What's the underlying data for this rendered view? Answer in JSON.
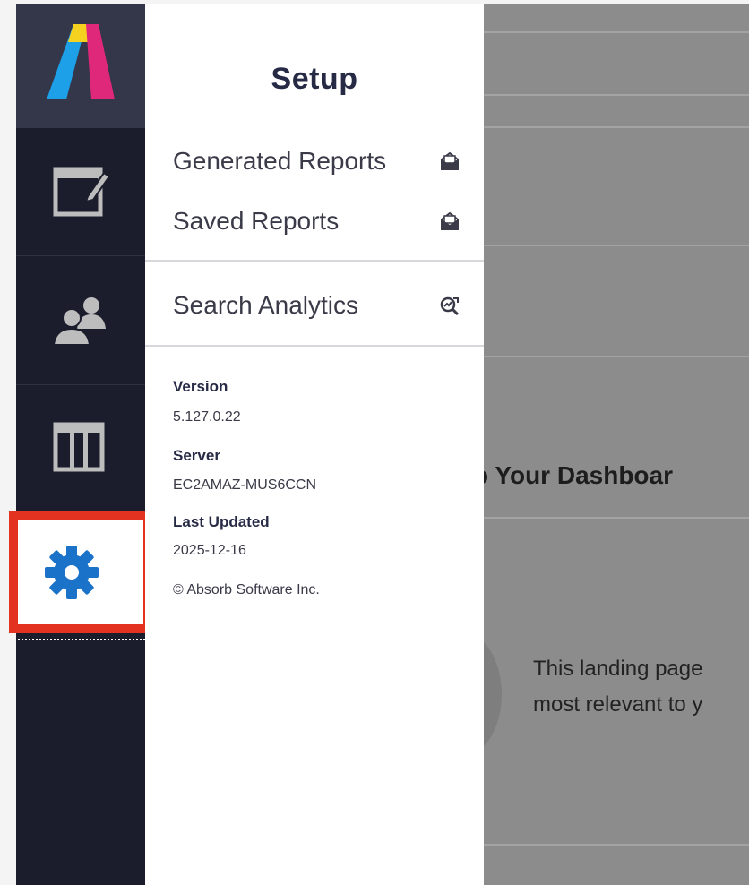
{
  "panel": {
    "title": "Setup",
    "menu": [
      {
        "label": "Generated Reports",
        "icon": "open-envelope-icon"
      },
      {
        "label": "Saved Reports",
        "icon": "open-envelope-icon"
      },
      {
        "label": "Search Analytics",
        "icon": "search-analytics-icon"
      }
    ],
    "info": {
      "version_label": "Version",
      "version_value": "5.127.0.22",
      "server_label": "Server",
      "server_value": "EC2AMAZ-MUS6CCN",
      "updated_label": "Last Updated",
      "updated_value": "2025-12-16",
      "copyright": "© Absorb Software Inc."
    }
  },
  "rail": {
    "items": [
      {
        "name": "logo",
        "icon": "absorb-logo-icon"
      },
      {
        "name": "edit",
        "icon": "edit-window-icon"
      },
      {
        "name": "users",
        "icon": "users-icon"
      },
      {
        "name": "columns",
        "icon": "columns-icon"
      },
      {
        "name": "setup",
        "icon": "gear-icon",
        "active": true
      }
    ],
    "active_highlight_color": "#e3321f",
    "gear_color": "#1a73c9"
  },
  "background": {
    "heading": "o Your Dashboar",
    "text_line1": "This landing page",
    "text_line2": "most relevant to y"
  }
}
